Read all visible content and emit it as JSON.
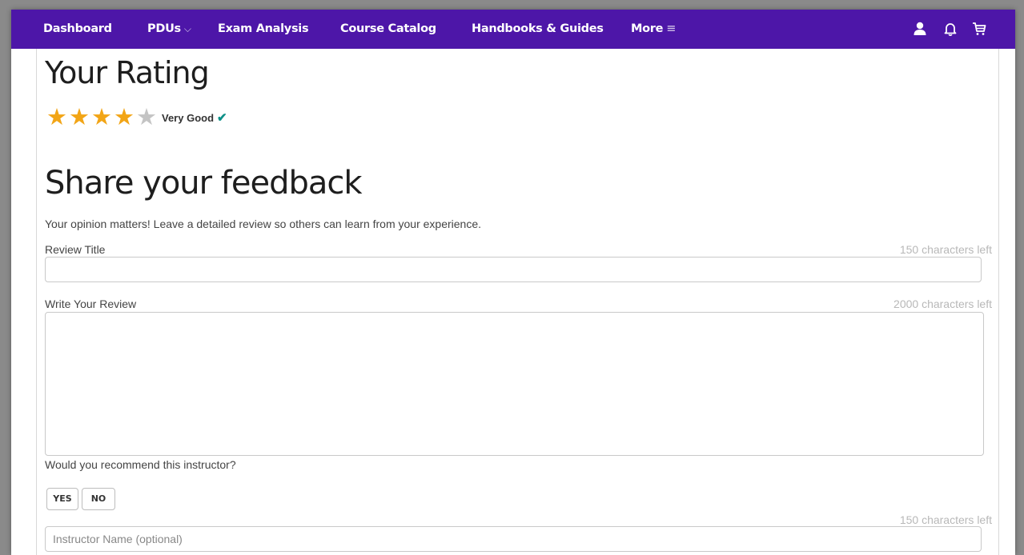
{
  "nav": {
    "items": [
      {
        "label": "Dashboard"
      },
      {
        "label": "PDUs"
      },
      {
        "label": "Exam Analysis"
      },
      {
        "label": "Course Catalog"
      },
      {
        "label": "Handbooks & Guides"
      },
      {
        "label": "More"
      }
    ],
    "pdus_chevron": "⌵",
    "more_icon": "≡",
    "icons": [
      "user-icon",
      "bell-icon",
      "cart-icon"
    ],
    "bar_color": "#4d16a8"
  },
  "rating": {
    "heading": "Your Rating",
    "value": 4,
    "max": 5,
    "label": "Very Good",
    "check": "✔",
    "star_color": "#f2a516"
  },
  "feedback": {
    "heading": "Share your feedback",
    "intro": "Your opinion matters! Leave a detailed review so others can learn from your experience.",
    "title_label": "Review Title",
    "title_counter": "150 characters left",
    "title_value": "",
    "review_label": "Write Your Review",
    "review_counter": "2000 characters left",
    "review_value": "",
    "recommend_question": "Would you recommend this instructor?",
    "yes_label": "YES",
    "no_label": "NO",
    "instructor_counter": "150 characters left",
    "instructor_placeholder": "Instructor Name (optional)",
    "instructor_value": ""
  }
}
